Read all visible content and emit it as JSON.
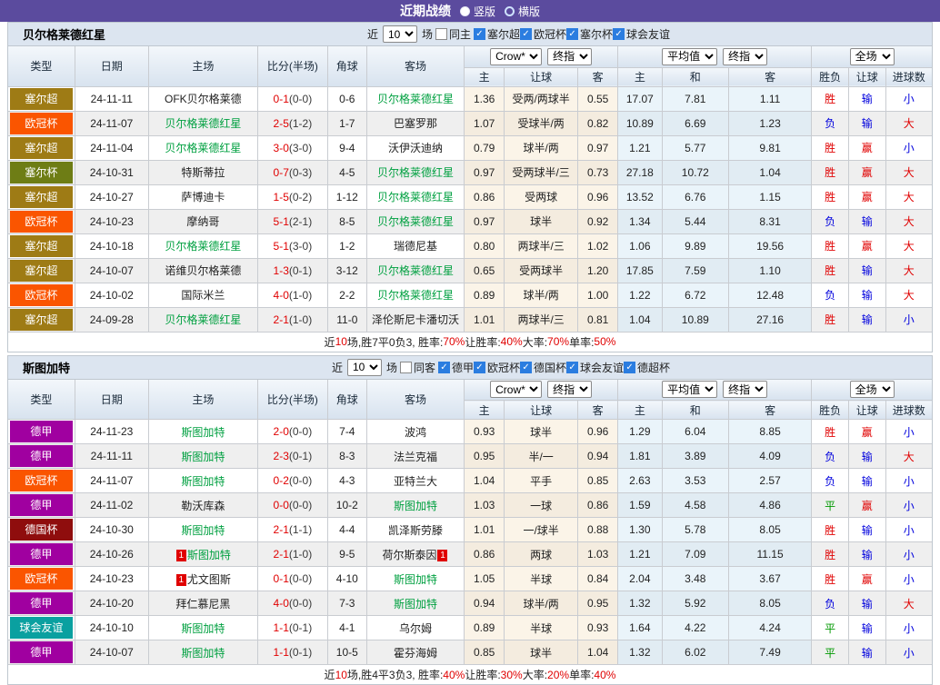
{
  "topbar": {
    "title": "近期战绩",
    "options": [
      {
        "label": "竖版",
        "selected": true
      },
      {
        "label": "横版",
        "selected": false
      }
    ]
  },
  "controls": {
    "crow": "Crow*",
    "final": "终指",
    "avg": "平均值",
    "full": "全场"
  },
  "columns": {
    "main": [
      "类型",
      "日期",
      "主场",
      "比分(半场)",
      "角球",
      "客场"
    ],
    "sub": [
      "主",
      "让球",
      "客",
      "主",
      "和",
      "客",
      "胜负",
      "让球",
      "进球数"
    ]
  },
  "theme": {
    "topbar_bg": "#5B4B9E",
    "band_bg": "#DCE5F0",
    "focus_team_color": "#00A040",
    "red": "#E00000",
    "blue": "#0000DD",
    "green": "#009900",
    "checkbox_blue": "#2B7DE0"
  },
  "type_colors": {
    "塞尔超": "#9E7B15",
    "欧冠杯": "#FA5500",
    "塞尔杯": "#6E7D15",
    "德甲": "#A000A0",
    "德国杯": "#8F0D0D",
    "球会友谊": "#0AA0A0"
  },
  "result_colors": {
    "胜": "#E00000",
    "负": "#0000DD",
    "平": "#009900",
    "赢": "#E00000",
    "输": "#0000DD",
    "大": "#E00000",
    "小": "#0000DD"
  },
  "sections": [
    {
      "team": "贝尔格莱德红星",
      "filter": {
        "near": "近",
        "games_value": "10",
        "games_unit": "场",
        "same": "同主",
        "same_checked": false,
        "leagues": [
          "塞尔超",
          "欧冠杯",
          "塞尔杯",
          "球会友谊"
        ]
      },
      "rows": [
        {
          "type": "塞尔超",
          "date": "24-11-11",
          "home": "OFK贝尔格莱德",
          "home_focus": false,
          "score": "0-1",
          "half": "(0-0)",
          "corner": "0-6",
          "away": "贝尔格莱德红星",
          "away_focus": true,
          "odds": [
            "1.36",
            "受两/两球半",
            "0.55"
          ],
          "avg": [
            "17.07",
            "7.81",
            "1.11"
          ],
          "result": [
            "胜",
            "输",
            "小"
          ]
        },
        {
          "type": "欧冠杯",
          "date": "24-11-07",
          "home": "贝尔格莱德红星",
          "home_focus": true,
          "score": "2-5",
          "half": "(1-2)",
          "corner": "1-7",
          "away": "巴塞罗那",
          "away_focus": false,
          "odds": [
            "1.07",
            "受球半/两",
            "0.82"
          ],
          "avg": [
            "10.89",
            "6.69",
            "1.23"
          ],
          "result": [
            "负",
            "输",
            "大"
          ]
        },
        {
          "type": "塞尔超",
          "date": "24-11-04",
          "home": "贝尔格莱德红星",
          "home_focus": true,
          "score": "3-0",
          "half": "(3-0)",
          "corner": "9-4",
          "away": "沃伊沃迪纳",
          "away_focus": false,
          "odds": [
            "0.79",
            "球半/两",
            "0.97"
          ],
          "avg": [
            "1.21",
            "5.77",
            "9.81"
          ],
          "result": [
            "胜",
            "赢",
            "小"
          ]
        },
        {
          "type": "塞尔杯",
          "date": "24-10-31",
          "home": "特斯蒂拉",
          "home_focus": false,
          "score": "0-7",
          "half": "(0-3)",
          "corner": "4-5",
          "away": "贝尔格莱德红星",
          "away_focus": true,
          "odds": [
            "0.97",
            "受两球半/三",
            "0.73"
          ],
          "avg": [
            "27.18",
            "10.72",
            "1.04"
          ],
          "result": [
            "胜",
            "赢",
            "大"
          ]
        },
        {
          "type": "塞尔超",
          "date": "24-10-27",
          "home": "萨博迪卡",
          "home_focus": false,
          "score": "1-5",
          "half": "(0-2)",
          "corner": "1-12",
          "away": "贝尔格莱德红星",
          "away_focus": true,
          "odds": [
            "0.86",
            "受两球",
            "0.96"
          ],
          "avg": [
            "13.52",
            "6.76",
            "1.15"
          ],
          "result": [
            "胜",
            "赢",
            "大"
          ]
        },
        {
          "type": "欧冠杯",
          "date": "24-10-23",
          "home": "摩纳哥",
          "home_focus": false,
          "score": "5-1",
          "half": "(2-1)",
          "corner": "8-5",
          "away": "贝尔格莱德红星",
          "away_focus": true,
          "odds": [
            "0.97",
            "球半",
            "0.92"
          ],
          "avg": [
            "1.34",
            "5.44",
            "8.31"
          ],
          "result": [
            "负",
            "输",
            "大"
          ]
        },
        {
          "type": "塞尔超",
          "date": "24-10-18",
          "home": "贝尔格莱德红星",
          "home_focus": true,
          "score": "5-1",
          "half": "(3-0)",
          "corner": "1-2",
          "away": "瑞德尼基",
          "away_focus": false,
          "odds": [
            "0.80",
            "两球半/三",
            "1.02"
          ],
          "avg": [
            "1.06",
            "9.89",
            "19.56"
          ],
          "result": [
            "胜",
            "赢",
            "大"
          ]
        },
        {
          "type": "塞尔超",
          "date": "24-10-07",
          "home": "诺维贝尔格莱德",
          "home_focus": false,
          "score": "1-3",
          "half": "(0-1)",
          "corner": "3-12",
          "away": "贝尔格莱德红星",
          "away_focus": true,
          "odds": [
            "0.65",
            "受两球半",
            "1.20"
          ],
          "avg": [
            "17.85",
            "7.59",
            "1.10"
          ],
          "result": [
            "胜",
            "输",
            "大"
          ]
        },
        {
          "type": "欧冠杯",
          "date": "24-10-02",
          "home": "国际米兰",
          "home_focus": false,
          "score": "4-0",
          "half": "(1-0)",
          "corner": "2-2",
          "away": "贝尔格莱德红星",
          "away_focus": true,
          "odds": [
            "0.89",
            "球半/两",
            "1.00"
          ],
          "avg": [
            "1.22",
            "6.72",
            "12.48"
          ],
          "result": [
            "负",
            "输",
            "大"
          ]
        },
        {
          "type": "塞尔超",
          "date": "24-09-28",
          "home": "贝尔格莱德红星",
          "home_focus": true,
          "score": "2-1",
          "half": "(1-0)",
          "corner": "11-0",
          "away": "泽伦斯尼卡潘切沃",
          "away_focus": false,
          "odds": [
            "1.01",
            "两球半/三",
            "0.81"
          ],
          "avg": [
            "1.04",
            "10.89",
            "27.16"
          ],
          "result": [
            "胜",
            "输",
            "小"
          ]
        }
      ],
      "summary": [
        {
          "t": "近",
          "c": "k"
        },
        {
          "t": "10",
          "c": "r"
        },
        {
          "t": "场,胜7平0负3, 胜率:",
          "c": "k"
        },
        {
          "t": "70%",
          "c": "r"
        },
        {
          "t": " 让胜率:",
          "c": "k"
        },
        {
          "t": "40%",
          "c": "r"
        },
        {
          "t": " 大率:",
          "c": "k"
        },
        {
          "t": "70%",
          "c": "r"
        },
        {
          "t": " 单率:",
          "c": "k"
        },
        {
          "t": "50%",
          "c": "r"
        }
      ]
    },
    {
      "team": "斯图加特",
      "filter": {
        "near": "近",
        "games_value": "10",
        "games_unit": "场",
        "same": "同客",
        "same_checked": false,
        "leagues": [
          "德甲",
          "欧冠杯",
          "德国杯",
          "球会友谊",
          "德超杯"
        ]
      },
      "rows": [
        {
          "type": "德甲",
          "date": "24-11-23",
          "home": "斯图加特",
          "home_focus": true,
          "score": "2-0",
          "half": "(0-0)",
          "corner": "7-4",
          "away": "波鸿",
          "away_focus": false,
          "odds": [
            "0.93",
            "球半",
            "0.96"
          ],
          "avg": [
            "1.29",
            "6.04",
            "8.85"
          ],
          "result": [
            "胜",
            "赢",
            "小"
          ]
        },
        {
          "type": "德甲",
          "date": "24-11-11",
          "home": "斯图加特",
          "home_focus": true,
          "score": "2-3",
          "half": "(0-1)",
          "corner": "8-3",
          "away": "法兰克福",
          "away_focus": false,
          "odds": [
            "0.95",
            "半/一",
            "0.94"
          ],
          "avg": [
            "1.81",
            "3.89",
            "4.09"
          ],
          "result": [
            "负",
            "输",
            "大"
          ]
        },
        {
          "type": "欧冠杯",
          "date": "24-11-07",
          "home": "斯图加特",
          "home_focus": true,
          "score": "0-2",
          "half": "(0-0)",
          "corner": "4-3",
          "away": "亚特兰大",
          "away_focus": false,
          "odds": [
            "1.04",
            "平手",
            "0.85"
          ],
          "avg": [
            "2.63",
            "3.53",
            "2.57"
          ],
          "result": [
            "负",
            "输",
            "小"
          ]
        },
        {
          "type": "德甲",
          "date": "24-11-02",
          "home": "勒沃库森",
          "home_focus": false,
          "score": "0-0",
          "half": "(0-0)",
          "corner": "10-2",
          "away": "斯图加特",
          "away_focus": true,
          "odds": [
            "1.03",
            "一球",
            "0.86"
          ],
          "avg": [
            "1.59",
            "4.58",
            "4.86"
          ],
          "result": [
            "平",
            "赢",
            "小"
          ]
        },
        {
          "type": "德国杯",
          "date": "24-10-30",
          "home": "斯图加特",
          "home_focus": true,
          "score": "2-1",
          "half": "(1-1)",
          "corner": "4-4",
          "away": "凯泽斯劳滕",
          "away_focus": false,
          "odds": [
            "1.01",
            "一/球半",
            "0.88"
          ],
          "avg": [
            "1.30",
            "5.78",
            "8.05"
          ],
          "result": [
            "胜",
            "输",
            "小"
          ]
        },
        {
          "type": "德甲",
          "date": "24-10-26",
          "home": "斯图加特",
          "home_focus": true,
          "home_badge": "1",
          "score": "2-1",
          "half": "(1-0)",
          "corner": "9-5",
          "away": "荷尔斯泰因",
          "away_focus": false,
          "away_badge": "1",
          "odds": [
            "0.86",
            "两球",
            "1.03"
          ],
          "avg": [
            "1.21",
            "7.09",
            "11.15"
          ],
          "result": [
            "胜",
            "输",
            "小"
          ]
        },
        {
          "type": "欧冠杯",
          "date": "24-10-23",
          "home": "尤文图斯",
          "home_focus": false,
          "home_badge": "1",
          "score": "0-1",
          "half": "(0-0)",
          "corner": "4-10",
          "away": "斯图加特",
          "away_focus": true,
          "odds": [
            "1.05",
            "半球",
            "0.84"
          ],
          "avg": [
            "2.04",
            "3.48",
            "3.67"
          ],
          "result": [
            "胜",
            "赢",
            "小"
          ]
        },
        {
          "type": "德甲",
          "date": "24-10-20",
          "home": "拜仁慕尼黑",
          "home_focus": false,
          "score": "4-0",
          "half": "(0-0)",
          "corner": "7-3",
          "away": "斯图加特",
          "away_focus": true,
          "odds": [
            "0.94",
            "球半/两",
            "0.95"
          ],
          "avg": [
            "1.32",
            "5.92",
            "8.05"
          ],
          "result": [
            "负",
            "输",
            "大"
          ]
        },
        {
          "type": "球会友谊",
          "date": "24-10-10",
          "home": "斯图加特",
          "home_focus": true,
          "score": "1-1",
          "half": "(0-1)",
          "corner": "4-1",
          "away": "乌尔姆",
          "away_focus": false,
          "odds": [
            "0.89",
            "半球",
            "0.93"
          ],
          "avg": [
            "1.64",
            "4.22",
            "4.24"
          ],
          "result": [
            "平",
            "输",
            "小"
          ]
        },
        {
          "type": "德甲",
          "date": "24-10-07",
          "home": "斯图加特",
          "home_focus": true,
          "score": "1-1",
          "half": "(0-1)",
          "corner": "10-5",
          "away": "霍芬海姆",
          "away_focus": false,
          "odds": [
            "0.85",
            "球半",
            "1.04"
          ],
          "avg": [
            "1.32",
            "6.02",
            "7.49"
          ],
          "result": [
            "平",
            "输",
            "小"
          ]
        }
      ],
      "summary": [
        {
          "t": "近",
          "c": "k"
        },
        {
          "t": "10",
          "c": "r"
        },
        {
          "t": "场,胜4平3负3, 胜率:",
          "c": "k"
        },
        {
          "t": "40%",
          "c": "r"
        },
        {
          "t": " 让胜率:",
          "c": "k"
        },
        {
          "t": "30%",
          "c": "r"
        },
        {
          "t": " 大率:",
          "c": "k"
        },
        {
          "t": "20%",
          "c": "r"
        },
        {
          "t": " 单率:",
          "c": "k"
        },
        {
          "t": "40%",
          "c": "r"
        }
      ]
    }
  ]
}
